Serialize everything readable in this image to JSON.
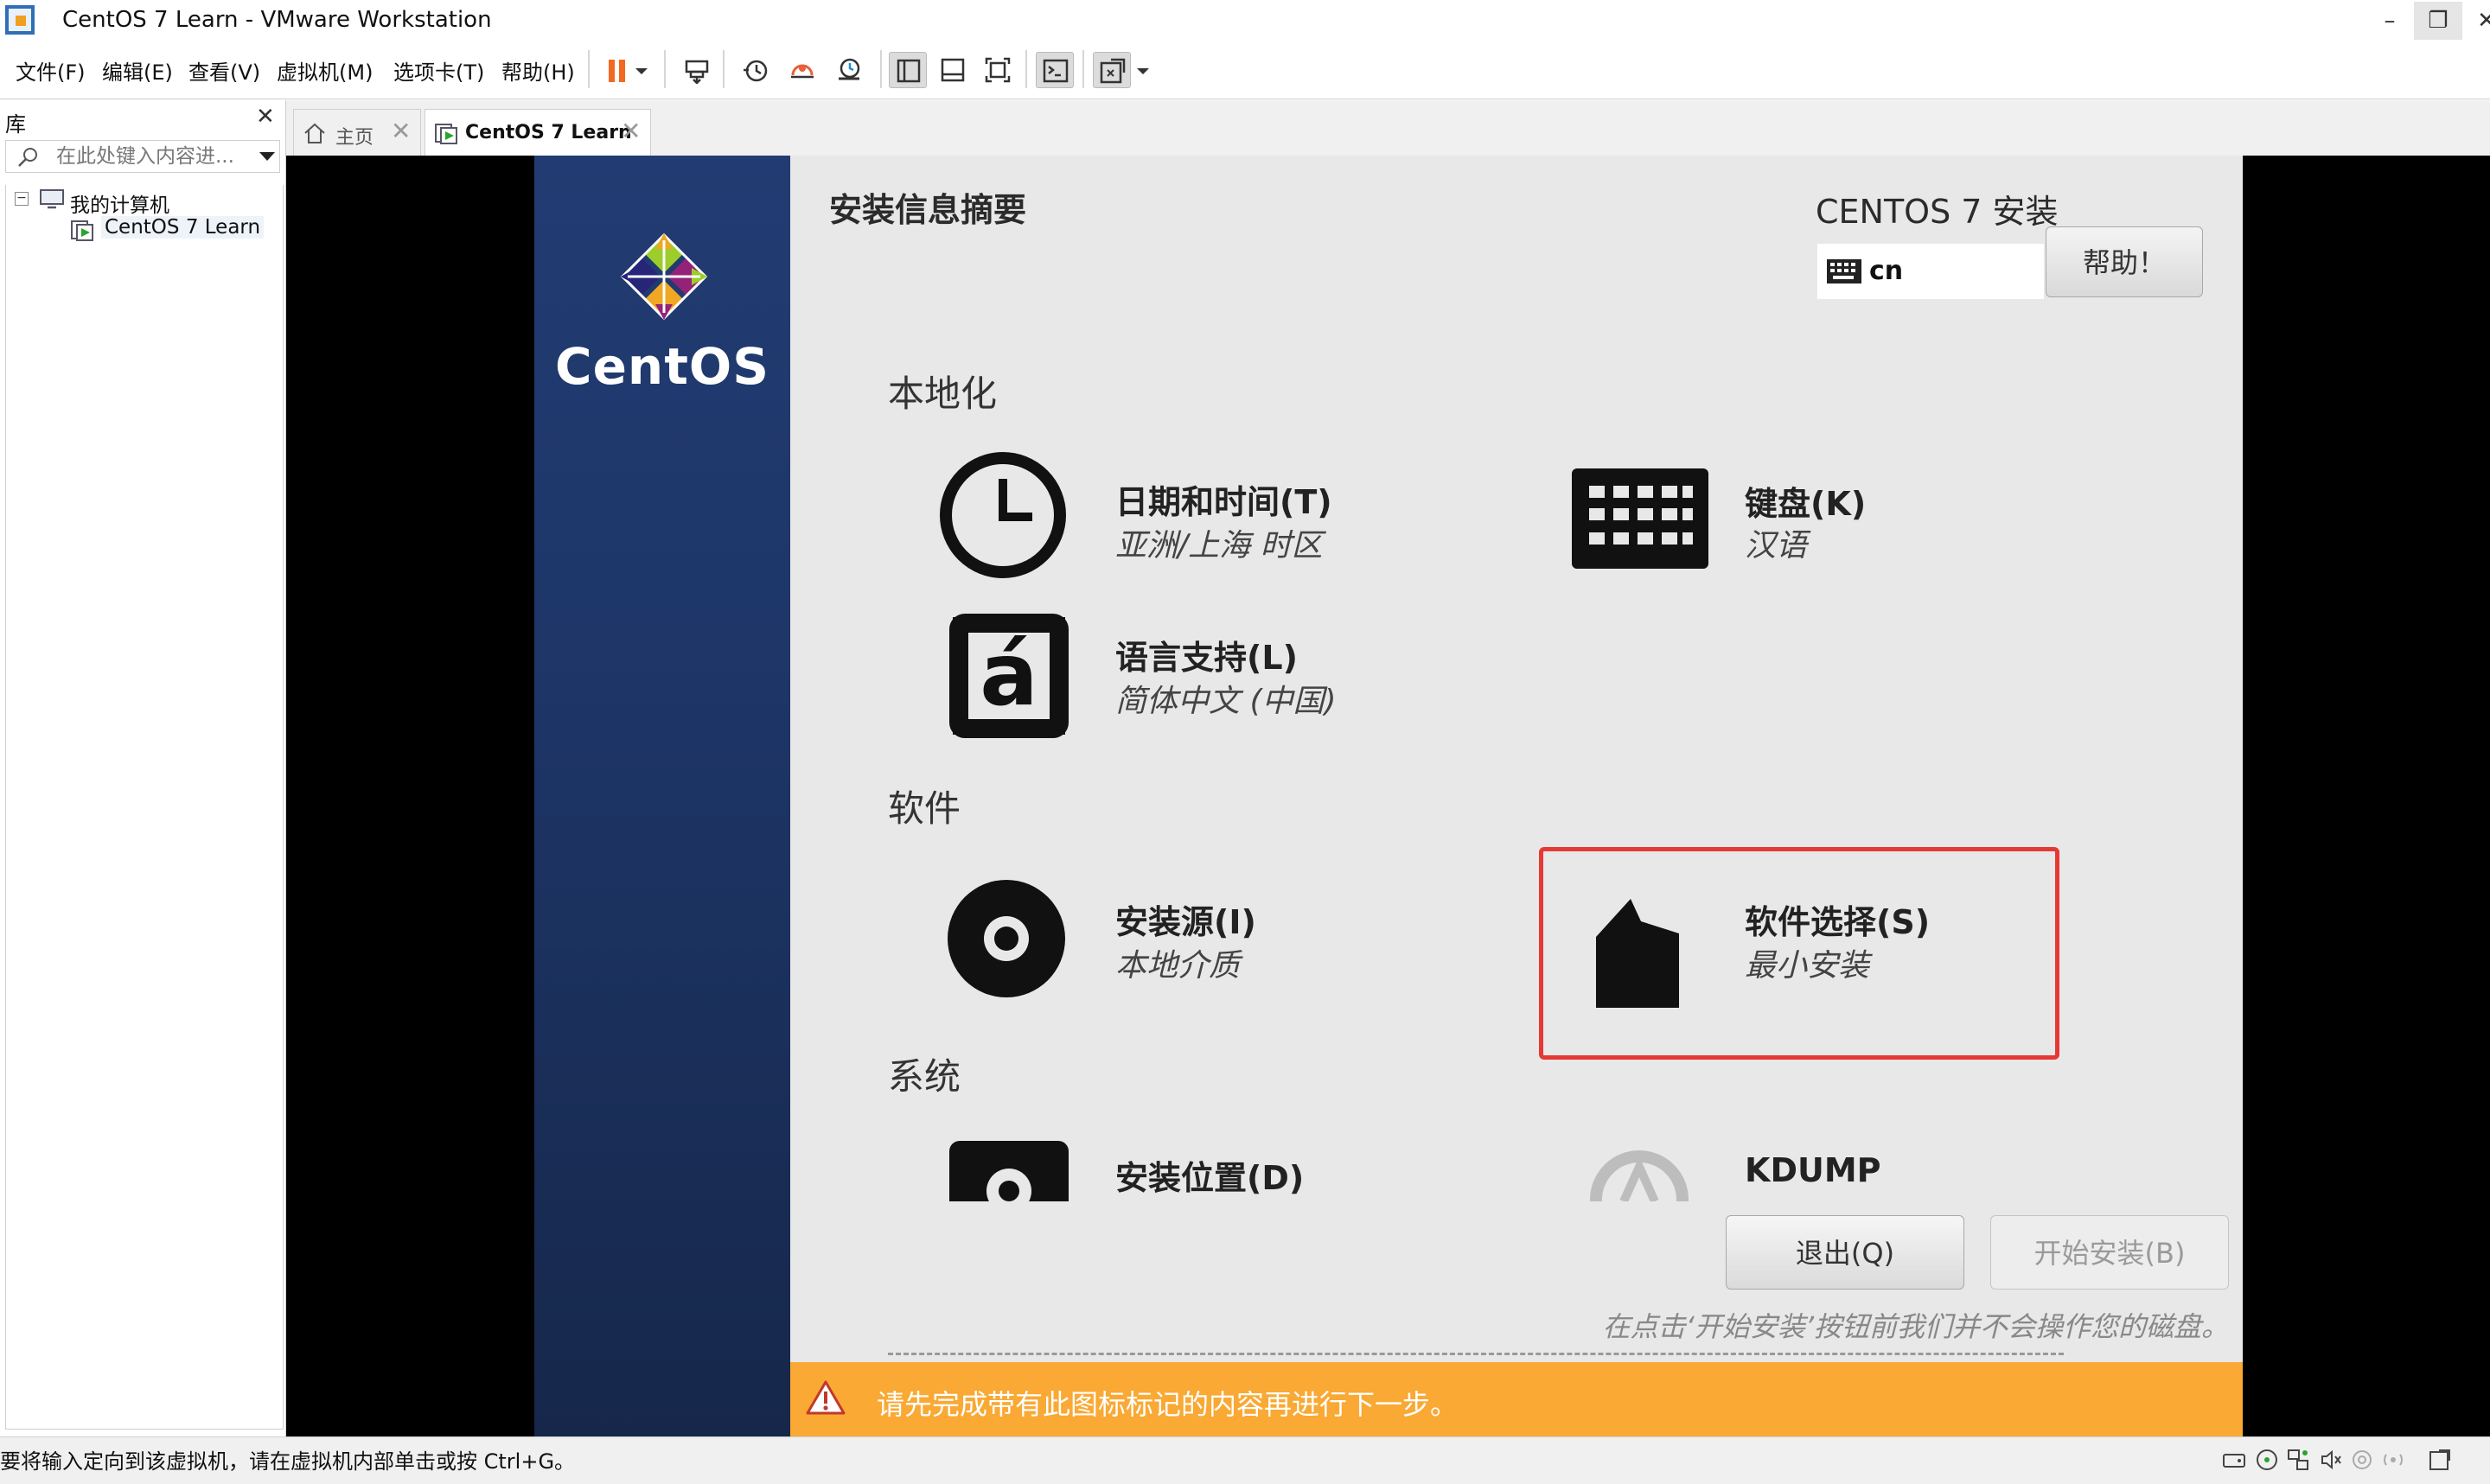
{
  "window": {
    "title": "CentOS 7 Learn - VMware Workstation",
    "controls": {
      "minimize": "–",
      "restore": "❐",
      "close": "✕"
    }
  },
  "menu": {
    "items": [
      "文件(F)",
      "编辑(E)",
      "查看(V)",
      "虚拟机(M)",
      "选项卡(T)",
      "帮助(H)"
    ]
  },
  "toolbar": {
    "icons": [
      "pause-icon",
      "dropdown-arrow-icon",
      "send-ctrl-alt-del-icon",
      "snapshot-take-icon",
      "snapshot-revert-icon",
      "snapshot-manager-icon",
      "library-view-icon",
      "thumbnail-view-icon",
      "fullscreen-icon",
      "console-icon",
      "stretch-icon",
      "dropdown-arrow-icon"
    ]
  },
  "library": {
    "title": "库",
    "close": "✕",
    "search_placeholder": "在此处键入内容进...",
    "tree": {
      "root": "我的计算机",
      "children": [
        "CentOS 7 Learn"
      ]
    }
  },
  "tabs": [
    {
      "label": "主页",
      "close": "✕",
      "active": false
    },
    {
      "label": "CentOS 7 Learn",
      "close": "✕",
      "active": true
    }
  ],
  "installer": {
    "brand": "CentOS",
    "hub_title": "安装信息摘要",
    "product_title": "CENTOS 7 安装",
    "keyboard_lang": "cn",
    "help_button": "帮助！",
    "categories": {
      "localization": "本地化",
      "software": "软件",
      "system": "系统"
    },
    "spokes": {
      "datetime": {
        "title": "日期和时间(T)",
        "status": "亚洲/上海 时区"
      },
      "keyboard": {
        "title": "键盘(K)",
        "status": "汉语"
      },
      "language": {
        "title": "语言支持(L)",
        "status": "简体中文 (中国)"
      },
      "source": {
        "title": "安装源(I)",
        "status": "本地介质"
      },
      "software": {
        "title": "软件选择(S)",
        "status": "最小安装"
      },
      "destination": {
        "title": "安装位置(D)"
      },
      "kdump": {
        "title": "KDUMP"
      }
    },
    "language_glyph": "á",
    "quit_button": "退出(Q)",
    "begin_button": "开始安装(B)",
    "disk_note": "在点击‘开始安装’按钮前我们并不会操作您的磁盘。",
    "warning": "请先完成带有此图标标记的内容再进行下一步。",
    "colors": {
      "warning_bar": "#f9a934",
      "highlight": "#e53935",
      "sidebar": "#1d3566"
    }
  },
  "statusbar": {
    "text": "要将输入定向到该虚拟机，请在虚拟机内部单击或按 Ctrl+G。",
    "icons": [
      "hard-disk-icon",
      "cd-rom-icon",
      "network-icon",
      "sound-icon",
      "usb-icon",
      "message-icon",
      "stretch-icon"
    ]
  }
}
